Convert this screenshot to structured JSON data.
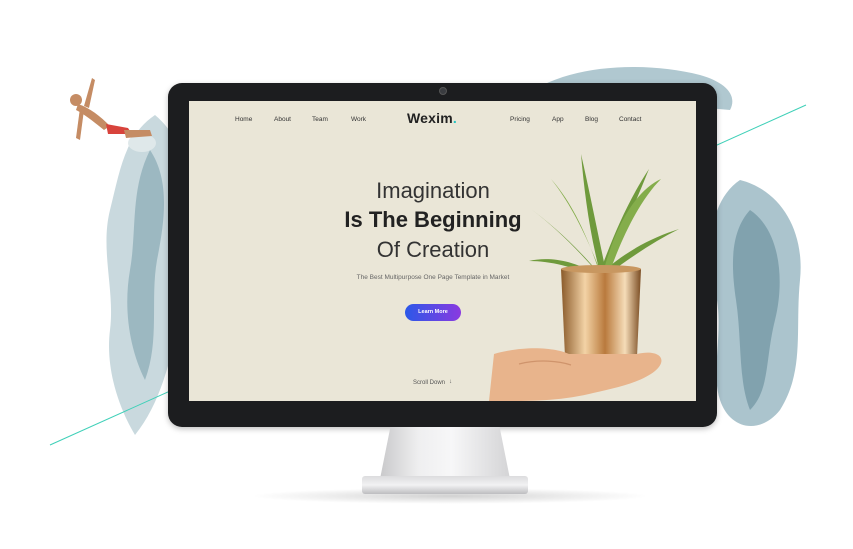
{
  "nav": {
    "left": [
      "Home",
      "About",
      "Team",
      "Work"
    ],
    "brand": "Wexim",
    "brand_dot": ".",
    "right": [
      "Pricing",
      "App",
      "Blog",
      "Contact"
    ]
  },
  "hero": {
    "line1": "Imagination",
    "line2": "Is The Beginning",
    "line3": "Of Creation",
    "subtitle": "The Best Multipurpose One Page Template in Market",
    "cta_label": "Learn More",
    "scroll_label": "Scroll Down",
    "scroll_icon": "↓"
  },
  "colors": {
    "accent": "#23c4c3",
    "button_start": "#2b58e8",
    "button_end": "#8a3ae0",
    "screen_bg": "#eae6d7"
  },
  "icons": {
    "scroll": "arrow-down-icon"
  }
}
